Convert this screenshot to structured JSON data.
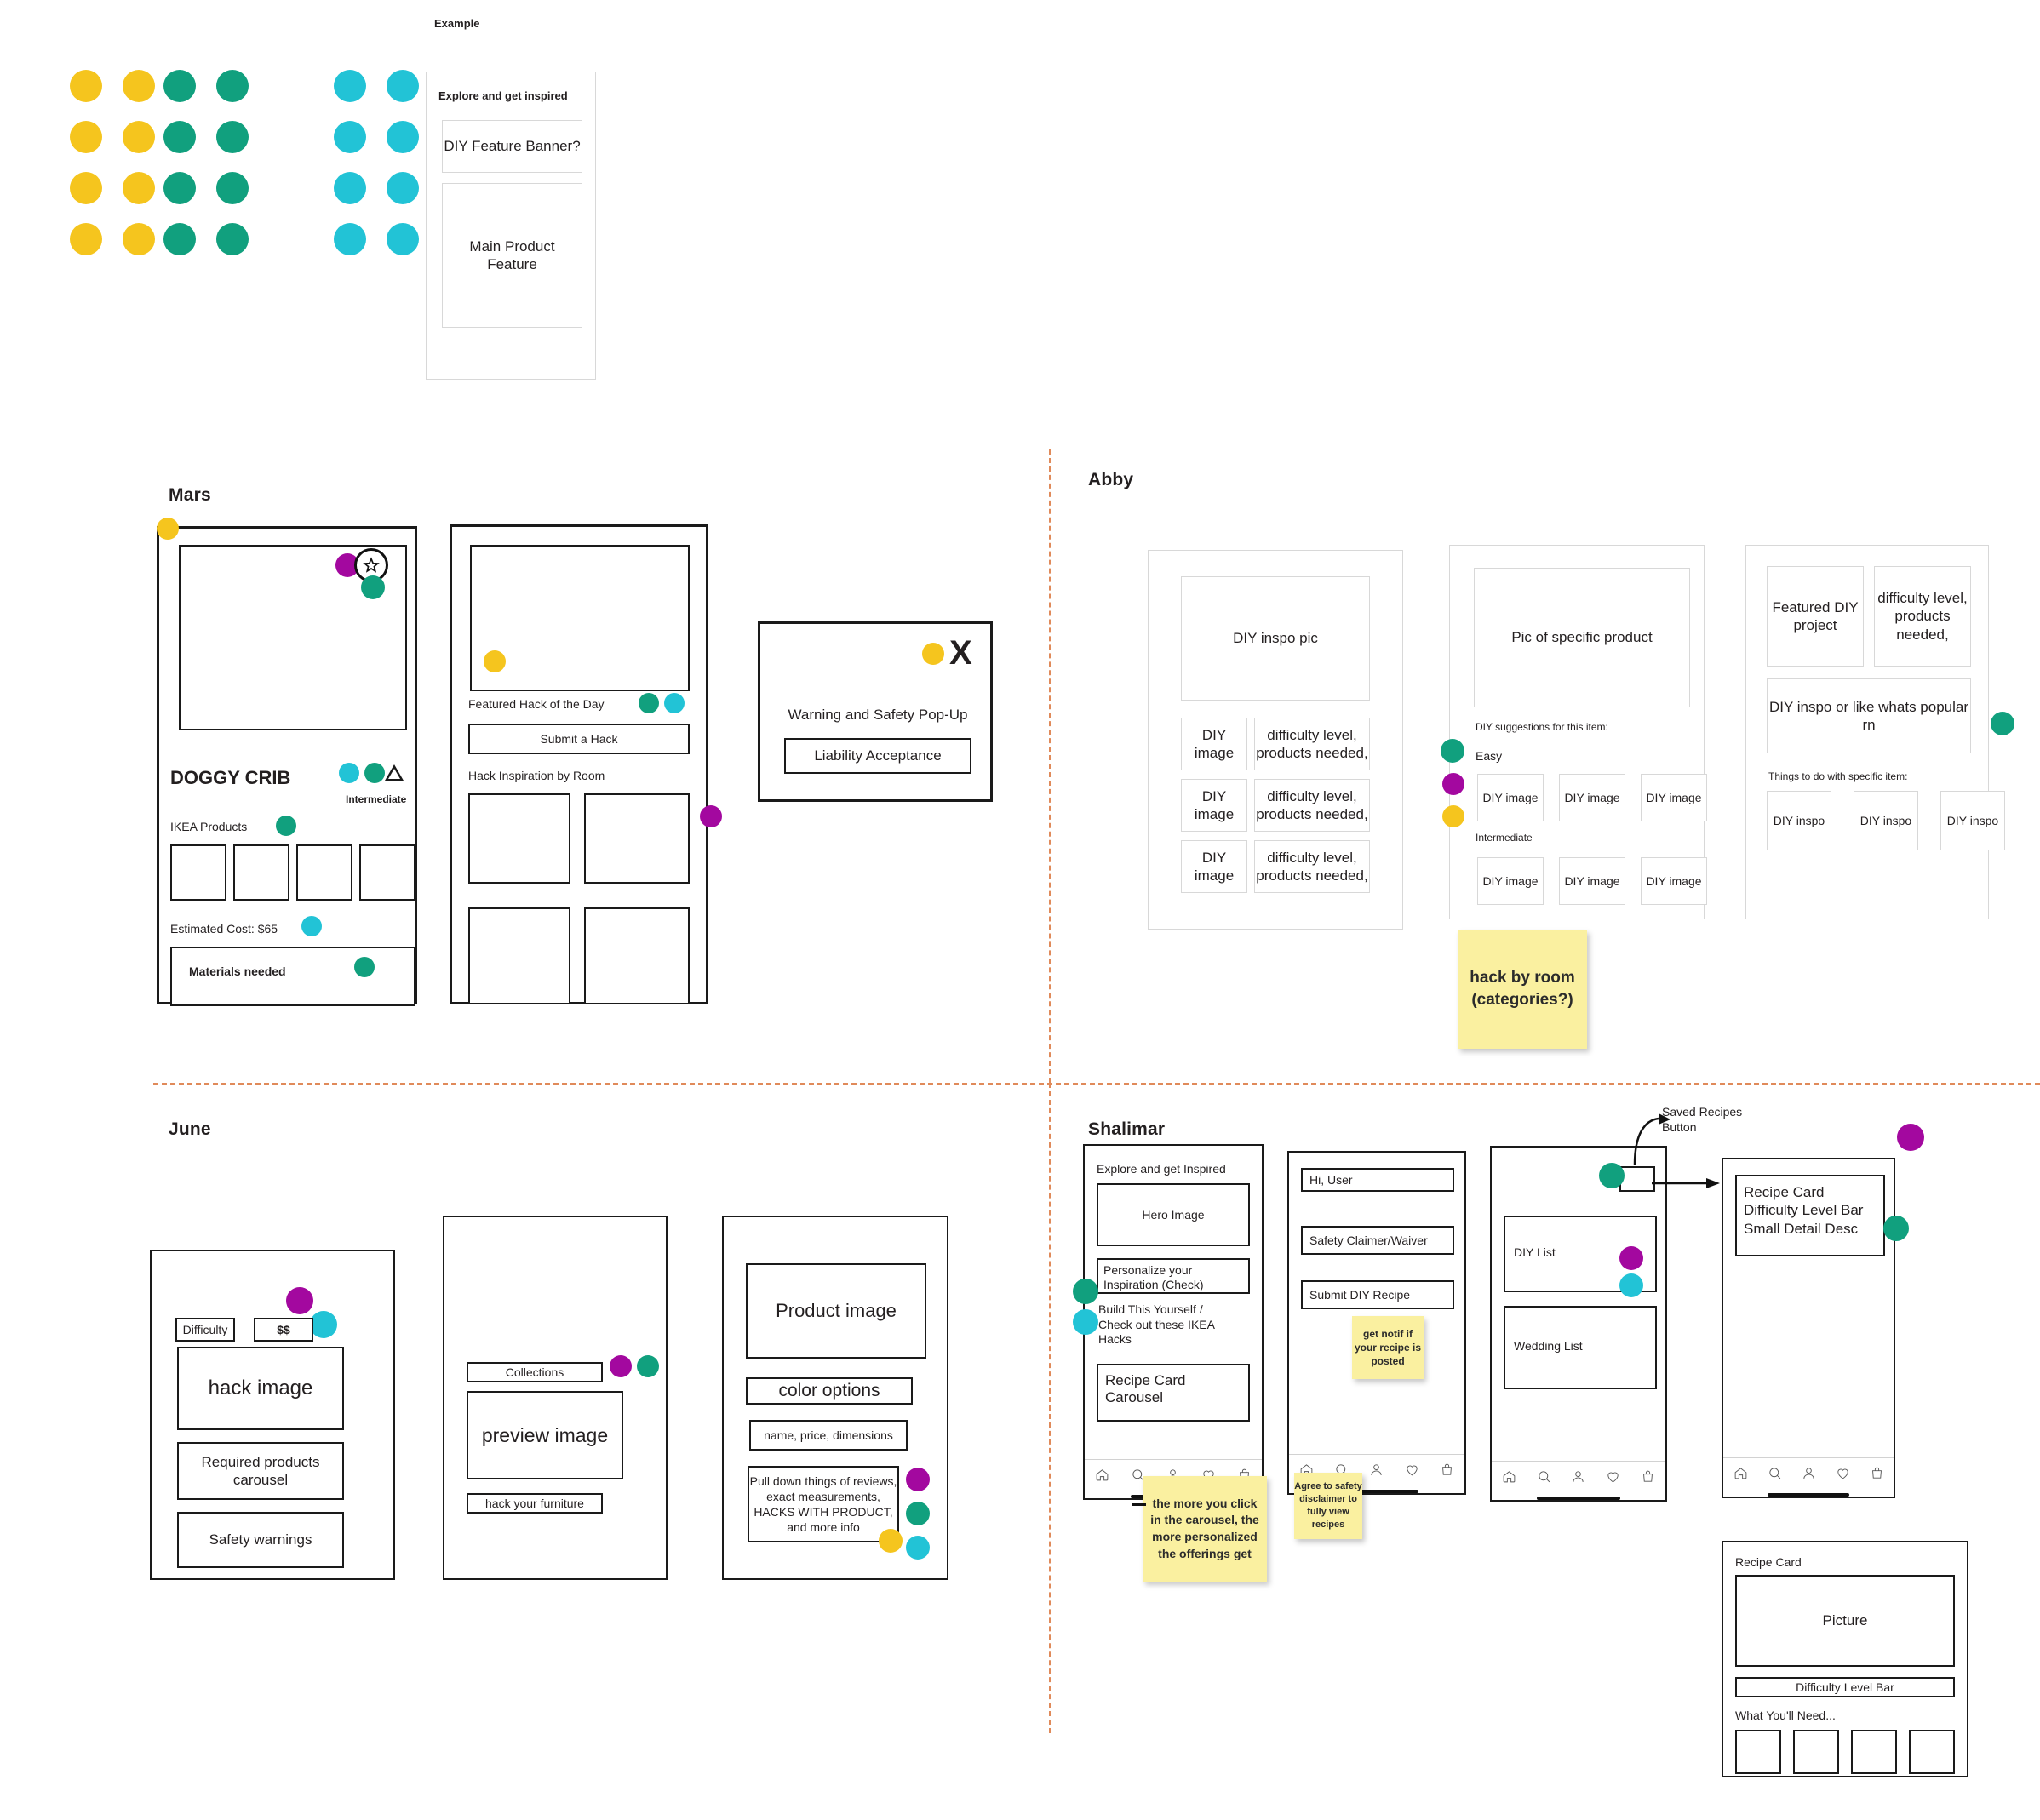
{
  "colors": {
    "yellow": "#f5c51e",
    "teal": "#11a07e",
    "cyan": "#22c3d6",
    "purple": "#a3089f",
    "sticky": "#faf0a0",
    "divider": "#e08a5a"
  },
  "example": {
    "label": "Example",
    "header": "Explore and get inspired",
    "banner": "DIY Feature Banner?",
    "main_feature": "Main Product Feature"
  },
  "swatches": [
    {
      "name": "yellow-dots",
      "color": "#f5c51e",
      "rows": 4,
      "cols": 2
    },
    {
      "name": "teal-dots",
      "color": "#11a07e",
      "rows": 4,
      "cols": 2
    },
    {
      "name": "cyan-dots",
      "color": "#22c3d6",
      "rows": 4,
      "cols": 2
    }
  ],
  "mars": {
    "title": "Mars",
    "screen1": {
      "product_title": "DOGGY CRIB",
      "difficulty": "Intermediate",
      "products_label": "IKEA Products",
      "cost": "Estimated Cost: $65",
      "materials": "Materials needed",
      "product_tiles": 4
    },
    "screen2": {
      "featured": "Featured Hack of the Day",
      "submit": "Submit a Hack",
      "inspiration": "Hack Inspiration by Room",
      "room_tiles": 4
    },
    "popup": {
      "close": "X",
      "title": "Warning and Safety Pop-Up",
      "button": "Liability Acceptance"
    }
  },
  "abby": {
    "title": "Abby",
    "screen1": {
      "hero": "DIY inspo pic",
      "rows": [
        {
          "image": "DIY image",
          "meta": "difficulty level,\nproducts needed,"
        },
        {
          "image": "DIY image",
          "meta": "difficulty level,\nproducts needed,"
        },
        {
          "image": "DIY image",
          "meta": "difficulty level,\nproducts needed,"
        }
      ]
    },
    "screen2": {
      "hero": "Pic of specific product",
      "suggestions_label": "DIY suggestions for this item:",
      "group_easy": "Easy",
      "group_intermediate": "Intermediate",
      "easy_items": [
        "DIY image",
        "DIY image",
        "DIY image"
      ],
      "intermediate_items": [
        "DIY image",
        "DIY image",
        "DIY image"
      ]
    },
    "screen3": {
      "featured": "Featured DIY project",
      "meta": "difficulty level, products needed,",
      "inspo": "DIY inspo or like whats popular rn",
      "things_label": "Things to do with specific item:",
      "things": [
        "DIY inspo",
        "DIY inspo",
        "DIY inspo"
      ]
    },
    "sticky": "hack by room (categories?)"
  },
  "june": {
    "title": "June",
    "screen1": {
      "difficulty": "Difficulty",
      "price": "$$",
      "hack_image": "hack image",
      "carousel": "Required products carousel",
      "safety": "Safety warnings"
    },
    "screen2": {
      "collections": "Collections",
      "preview": "preview image",
      "hack_furniture": "hack your furniture"
    },
    "screen3": {
      "product_image": "Product image",
      "color_options": "color options",
      "name_price": "name, price, dimensions",
      "pulldown": "Pull down things of reviews, exact measurements, HACKS WITH PRODUCT, and more info"
    }
  },
  "shalimar": {
    "title": "Shalimar",
    "screen1": {
      "header": "Explore and get Inspired",
      "hero": "Hero Image",
      "personalize": "Personalize your Inspiration (Check)",
      "build": "Build This Yourself / Check out these IKEA Hacks",
      "carousel": "Recipe Card Carousel"
    },
    "screen2": {
      "greeting": "Hi, User",
      "waiver": "Safety Claimer/Waiver",
      "submit": "Submit DIY Recipe"
    },
    "screen3": {
      "diy_list": "DIY List",
      "wedding_list": "Wedding List",
      "saved_button_label": "Saved Recipes Button"
    },
    "screen4": {
      "card": "Recipe Card Difficulty Level Bar Small Detail Desc"
    },
    "recipe_card": {
      "title": "Recipe Card",
      "picture": "Picture",
      "difficulty_bar": "Difficulty Level Bar",
      "need_label": "What You'll Need...",
      "need_tiles": 4
    },
    "stickies": [
      "the more you click in the carousel, the more personalized the offerings get",
      "get notif if your recipe is posted",
      "Agree to safety disclaimer to fully view recipes"
    ]
  },
  "nav_icons": [
    "home-icon",
    "search-icon",
    "person-icon",
    "heart-icon",
    "bag-icon"
  ]
}
